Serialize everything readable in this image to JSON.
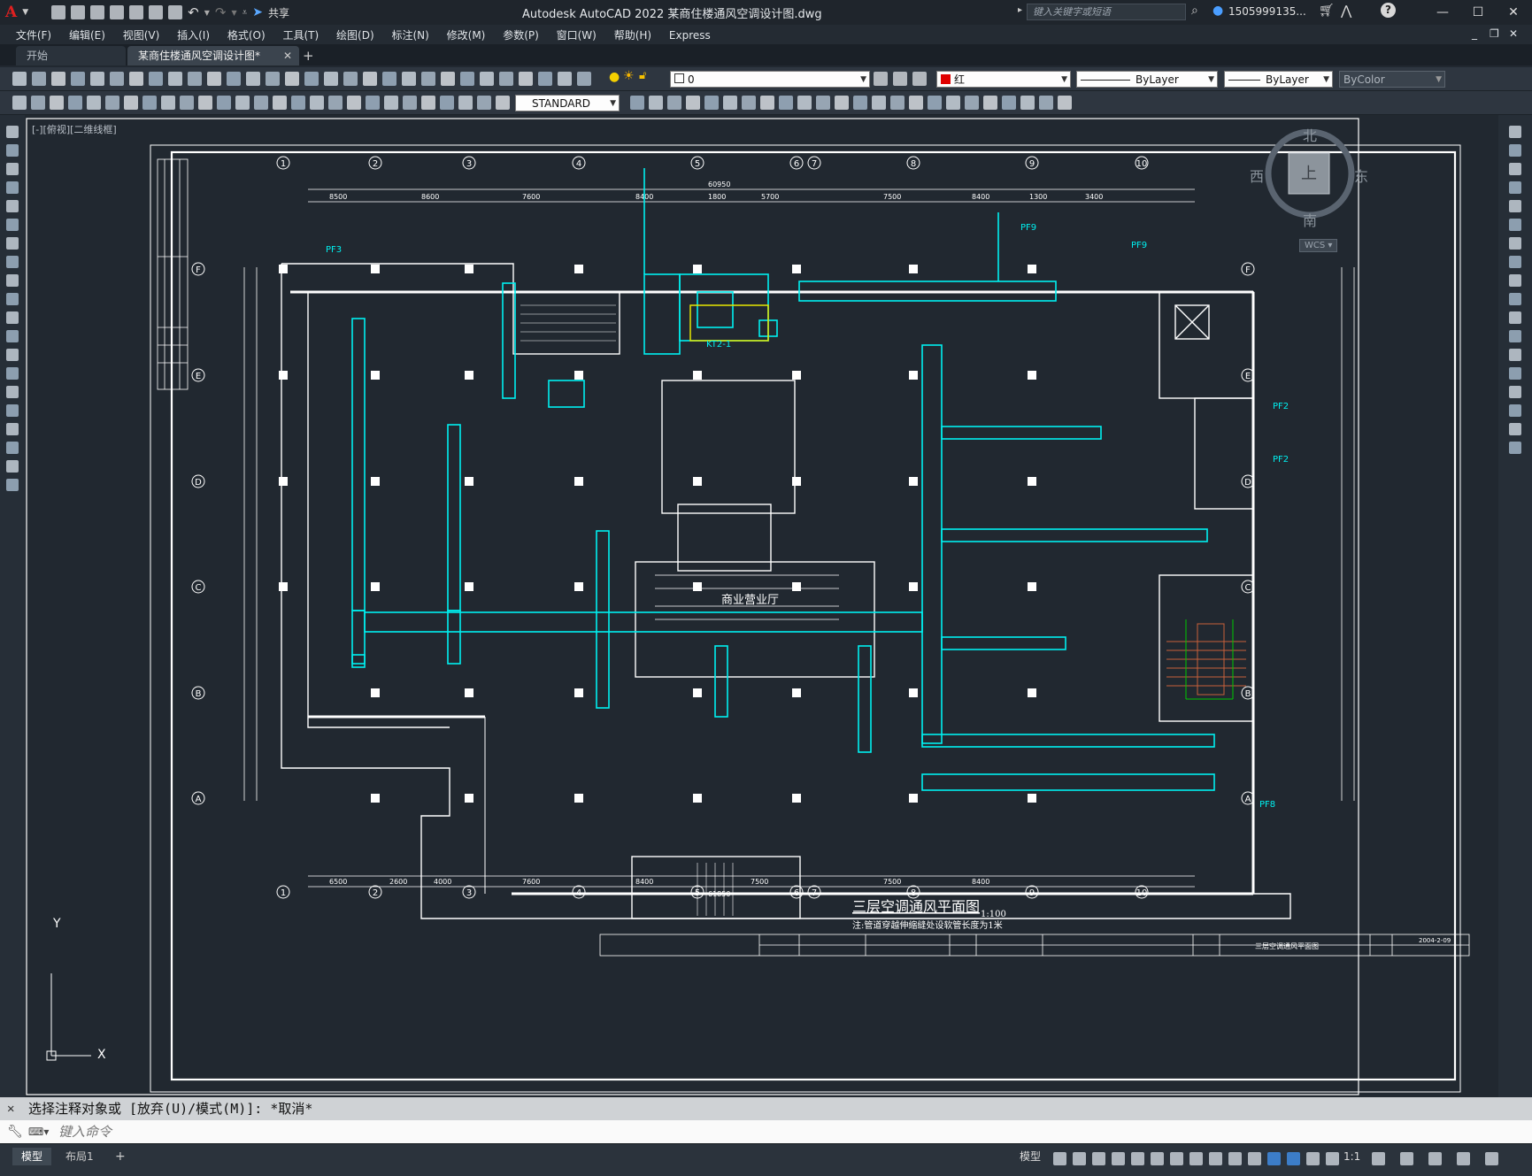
{
  "titlebar": {
    "app_logo": "A",
    "share_label": "共享",
    "title": "Autodesk AutoCAD 2022    某商住楼通风空调设计图.dwg",
    "search_placeholder": "键入关键字或短语",
    "user": "1505999135...",
    "minimize": "—",
    "restore": "☐",
    "close": "✕"
  },
  "menu": [
    "文件(F)",
    "编辑(E)",
    "视图(V)",
    "插入(I)",
    "格式(O)",
    "工具(T)",
    "绘图(D)",
    "标注(N)",
    "修改(M)",
    "参数(P)",
    "窗口(W)",
    "帮助(H)",
    "Express"
  ],
  "tabs": {
    "start": "开始",
    "active": "某商住楼通风空调设计图*",
    "add": "+"
  },
  "properties": {
    "layer": "0",
    "color": "红",
    "linetype": "ByLayer",
    "lineweight": "ByLayer",
    "plotstyle": "ByColor",
    "textstyle": "STANDARD"
  },
  "viewport_label": "[-][俯视][二维线框]",
  "viewcube": {
    "north": "北",
    "south": "南",
    "east": "东",
    "west": "西",
    "top": "上",
    "wcs": "WCS"
  },
  "ucs": {
    "x": "X",
    "y": "Y"
  },
  "drawing": {
    "title": "三层空调通风平面图",
    "scale": "1:100",
    "note": "注:管道穿越伸缩缝处设软管长度为1米",
    "hall_label": "商业营业厅",
    "grid_cols": [
      "1",
      "2",
      "3",
      "4",
      "5",
      "6",
      "7",
      "8",
      "9",
      "10"
    ],
    "grid_rows": [
      "F",
      "E",
      "D",
      "C",
      "B",
      "A"
    ],
    "top_dims": [
      "8500",
      "8600",
      "7600",
      "8400",
      "1800",
      "5700",
      "7500",
      "8400",
      "1300",
      "3400"
    ],
    "top_total": "60950",
    "bottom_dims": [
      "6500",
      "2600",
      "4000",
      "7600",
      "8400",
      "7500",
      "7500",
      "8400"
    ],
    "bottom_total": "61850",
    "labels": [
      "PF3",
      "PF9",
      "PF9",
      "PF2",
      "PF2",
      "PF8",
      "KT2-1"
    ],
    "titleblock_name": "三层空调通风平面图",
    "titleblock_date": "2004-2-09"
  },
  "command": {
    "history": "选择注释对象或 [放弃(U)/模式(M)]: *取消*",
    "placeholder": "键入命令"
  },
  "status": {
    "model_tab": "模型",
    "layout_tab": "布局1",
    "add": "+",
    "model_btn": "模型",
    "scale": "1:1"
  },
  "colors": {
    "accent_cyan": "#00f0f0",
    "drawing_white": "#ffffff",
    "yellow": "#e8e800",
    "green": "#00c800",
    "red_swatch": "#e00000",
    "background": "#212830"
  }
}
